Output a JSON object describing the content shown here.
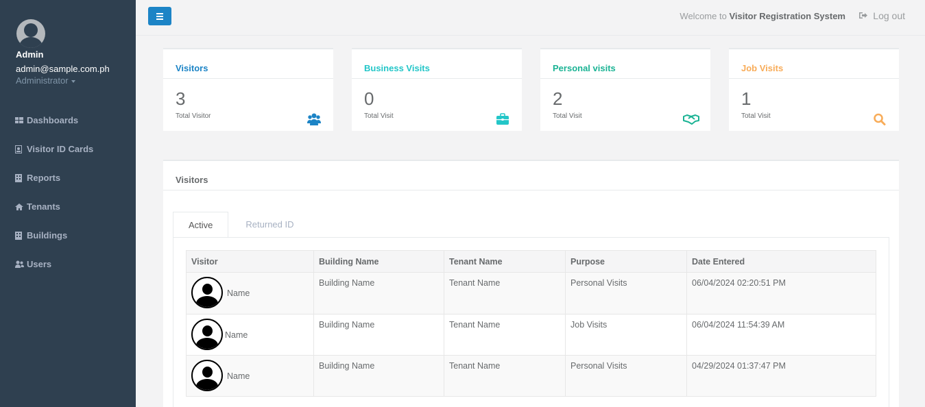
{
  "sidebar": {
    "user": {
      "name": "Admin",
      "email": "admin@sample.com.ph",
      "role": "Administrator"
    },
    "items": [
      {
        "label": "Dashboards",
        "icon": "th-large-icon"
      },
      {
        "label": "Visitor ID Cards",
        "icon": "id-card-icon"
      },
      {
        "label": "Reports",
        "icon": "building-icon"
      },
      {
        "label": "Tenants",
        "icon": "home-icon"
      },
      {
        "label": "Buildings",
        "icon": "building-icon"
      },
      {
        "label": "Users",
        "icon": "users-icon"
      }
    ]
  },
  "topbar": {
    "welcome_prefix": "Welcome to",
    "welcome_system": "Visitor Registration System",
    "logout": "Log out"
  },
  "cards": [
    {
      "title": "Visitors",
      "value": "3",
      "caption": "Total Visitor",
      "color": "#1c84c6",
      "icon": "users-icon"
    },
    {
      "title": "Business Visits",
      "value": "0",
      "caption": "Total Visit",
      "color": "#23c6c8",
      "icon": "briefcase-icon"
    },
    {
      "title": "Personal visits",
      "value": "2",
      "caption": "Total Visit",
      "color": "#1ab394",
      "icon": "handshake-icon"
    },
    {
      "title": "Job Visits",
      "value": "1",
      "caption": "Total Visit",
      "color": "#f8ac59",
      "icon": "search-icon"
    }
  ],
  "panel": {
    "title": "Visitors",
    "tabs": [
      "Active",
      "Returned ID"
    ],
    "columns": [
      "Visitor",
      "Building Name",
      "Tenant Name",
      "Purpose",
      "Date Entered"
    ],
    "rows": [
      {
        "visitor": "Name",
        "building": "Building Name",
        "tenant": "Tenant Name",
        "purpose": "Personal Visits",
        "date": "06/04/2024 02:20:51 PM"
      },
      {
        "visitor": "Name",
        "building": "Building Name",
        "tenant": "Tenant Name",
        "purpose": "Job Visits",
        "date": "06/04/2024 11:54:39 AM"
      },
      {
        "visitor": "Name",
        "building": "Building Name",
        "tenant": "Tenant Name",
        "purpose": "Personal Visits",
        "date": "04/29/2024 01:37:47 PM"
      }
    ]
  }
}
